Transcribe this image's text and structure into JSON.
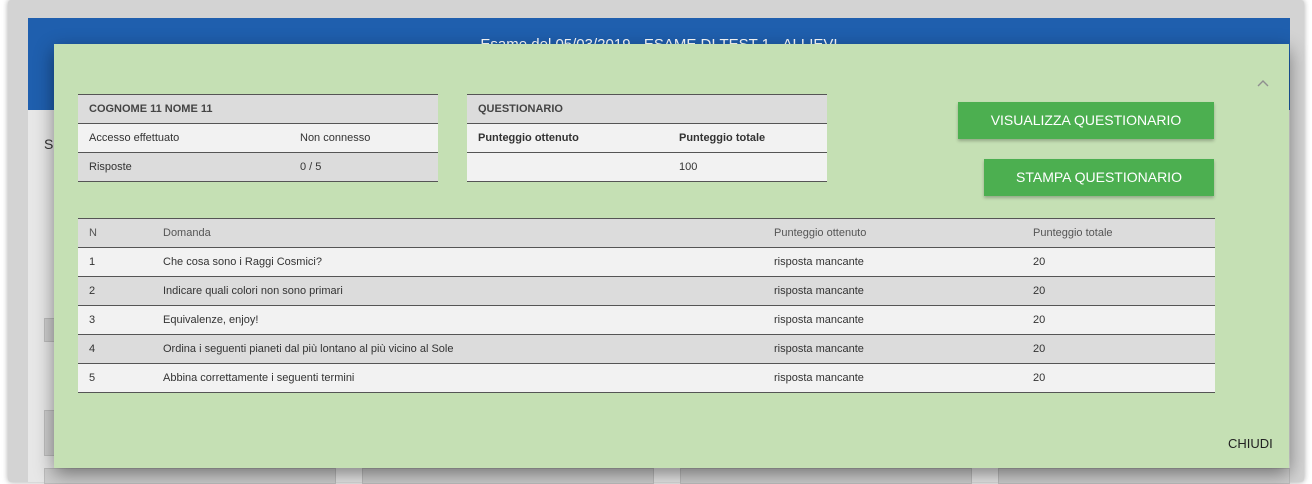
{
  "background": {
    "header_title": "Esame del 05/03/2019 - ESAME DI TEST 1 - ALLIEVI",
    "side_letter": "S"
  },
  "student": {
    "name": "COGNOME 11 NOME 11",
    "access_label": "Accesso effettuato",
    "access_value": "Non connesso",
    "answers_label": "Risposte",
    "answers_value": "0 / 5"
  },
  "questionnaire": {
    "title": "QUESTIONARIO",
    "col_obtained": "Punteggio ottenuto",
    "col_total": "Punteggio totale",
    "obtained_value": "",
    "total_value": "100"
  },
  "buttons": {
    "view": "VISUALIZZA QUESTIONARIO",
    "print": "STAMPA QUESTIONARIO",
    "close": "CHIUDI"
  },
  "questions": {
    "headers": [
      "N",
      "Domanda",
      "Punteggio ottenuto",
      "Punteggio totale"
    ],
    "rows": [
      {
        "n": "1",
        "question": "Che cosa sono i Raggi Cosmici?",
        "obtained": "risposta mancante",
        "total": "20"
      },
      {
        "n": "2",
        "question": "Indicare quali colori non sono primari",
        "obtained": "risposta mancante",
        "total": "20"
      },
      {
        "n": "3",
        "question": "Equivalenze, enjoy!",
        "obtained": "risposta mancante",
        "total": "20"
      },
      {
        "n": "4",
        "question": "Ordina i seguenti pianeti dal più lontano al più vicino al Sole",
        "obtained": "risposta mancante",
        "total": "20"
      },
      {
        "n": "5",
        "question": "Abbina correttamente i seguenti termini",
        "obtained": "risposta mancante",
        "total": "20"
      }
    ]
  },
  "icons": {
    "collapse": "chevron-up-icon"
  },
  "colors": {
    "modal_bg": "#c5e0b4",
    "button_bg": "#4caf50",
    "header_bg": "#1f5fae"
  }
}
